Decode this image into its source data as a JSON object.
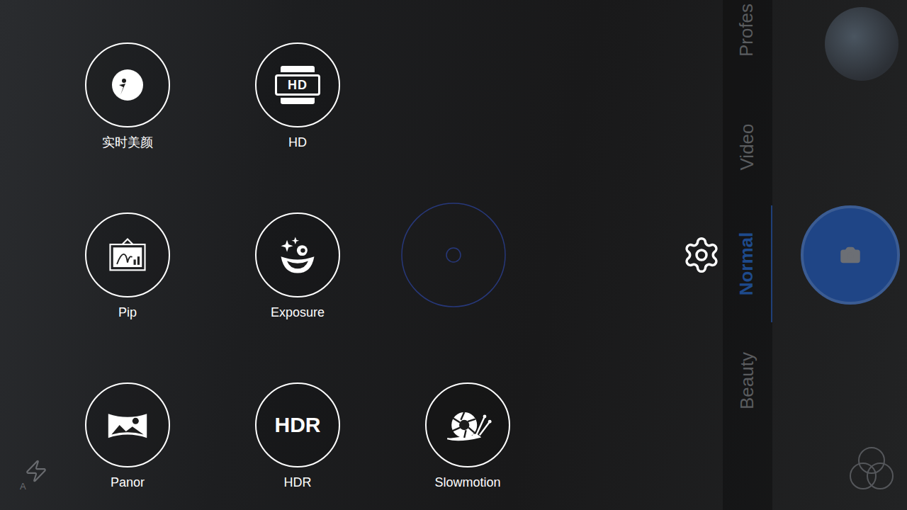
{
  "mode_rows": [
    [
      {
        "label": "实时美颜",
        "kind": "svg-icon"
      },
      {
        "label": "HD",
        "kind": "badge-icon",
        "icon_text": "HD"
      }
    ],
    [
      {
        "label": "Pip",
        "kind": "svg-icon"
      },
      {
        "label": "Exposure",
        "kind": "svg-icon"
      }
    ],
    [
      {
        "label": "Panor",
        "kind": "svg-icon"
      },
      {
        "label": "HDR",
        "kind": "text-icon",
        "icon_text": "HDR"
      },
      {
        "label": "Slowmotion",
        "kind": "svg-icon"
      }
    ]
  ],
  "camera_modes": [
    {
      "label": "Profes",
      "selected": false
    },
    {
      "label": "Video",
      "selected": false
    },
    {
      "label": "Normal",
      "selected": true
    },
    {
      "label": "Beauty",
      "selected": false
    }
  ],
  "flash": {
    "mode_text": "A"
  }
}
